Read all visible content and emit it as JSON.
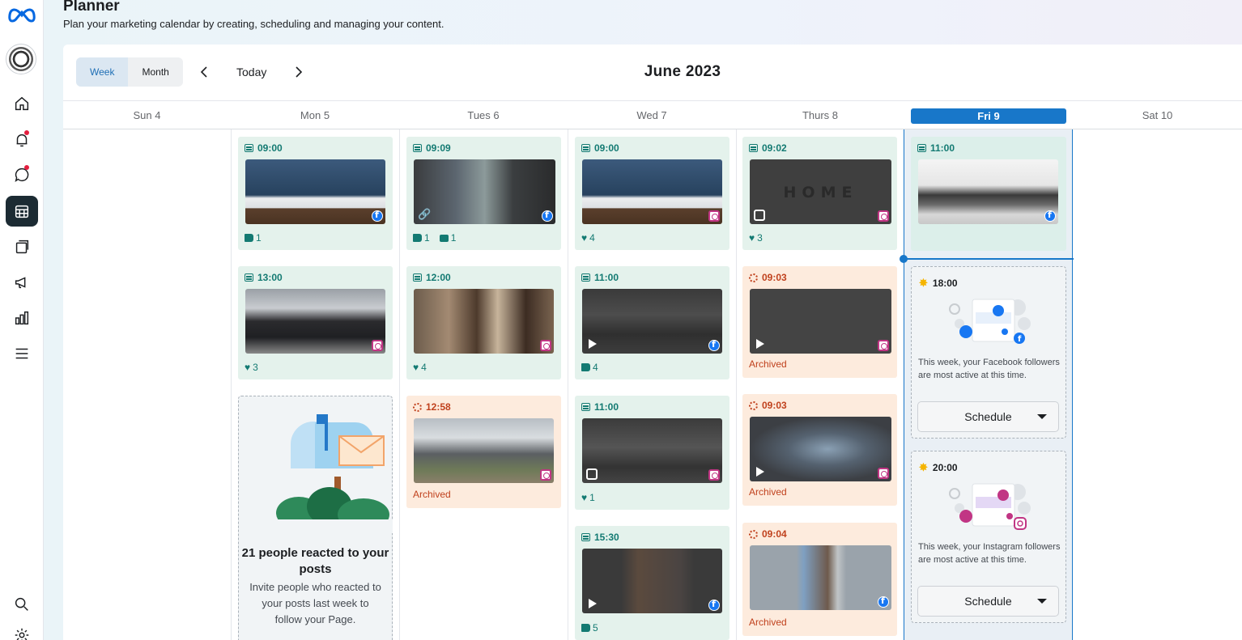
{
  "header": {
    "title": "Planner",
    "subtitle": "Plan your marketing calendar by creating, scheduling and managing your content."
  },
  "toolbar": {
    "week_label": "Week",
    "month_label": "Month",
    "today_label": "Today",
    "month_title": "June 2023"
  },
  "days": [
    "Sun 4",
    "Mon 5",
    "Tues 6",
    "Wed 7",
    "Thurs 8",
    "Fri 9",
    "Sat 10"
  ],
  "posts": {
    "mon": [
      {
        "time": "09:00",
        "stats": [
          "1"
        ]
      },
      {
        "time": "13:00",
        "stats": [
          "3"
        ]
      }
    ],
    "tue": [
      {
        "time": "09:09",
        "stats": [
          "1",
          "1"
        ]
      },
      {
        "time": "12:00",
        "stats": [
          "4"
        ]
      },
      {
        "time": "12:58",
        "status": "Archived"
      }
    ],
    "wed": [
      {
        "time": "09:00",
        "stats": [
          "4"
        ]
      },
      {
        "time": "11:00",
        "stats": [
          "4"
        ]
      },
      {
        "time": "11:00",
        "stats": [
          "1"
        ]
      },
      {
        "time": "15:30",
        "stats": [
          "5"
        ]
      }
    ],
    "thu": [
      {
        "time": "09:02",
        "stats": [
          "3"
        ],
        "overlay": "HOME"
      },
      {
        "time": "09:03",
        "status": "Archived"
      },
      {
        "time": "09:03",
        "status": "Archived"
      },
      {
        "time": "09:04",
        "status": "Archived"
      }
    ],
    "fri": [
      {
        "time": "11:00"
      }
    ]
  },
  "promo": {
    "heading": "21 people reacted to your posts",
    "body": "Invite people who reacted to your posts last week to follow your Page."
  },
  "suggestions": [
    {
      "time": "18:00",
      "text": "This week, your Facebook followers are most active at this time.",
      "button": "Schedule"
    },
    {
      "time": "20:00",
      "text": "This week, your Instagram followers are most active at this time.",
      "button": "Schedule"
    }
  ],
  "colors": {
    "accent": "#1877c9",
    "published_bg": "#e4f2ec",
    "archived_bg": "#fdebdd",
    "published_text": "#137a72",
    "archived_text": "#c0411d"
  },
  "icons": [
    "meta-logo-icon",
    "home-icon",
    "bell-icon",
    "chat-icon",
    "calendar-icon",
    "content-icon",
    "megaphone-icon",
    "insights-icon",
    "menu-icon",
    "search-icon",
    "settings-icon"
  ]
}
